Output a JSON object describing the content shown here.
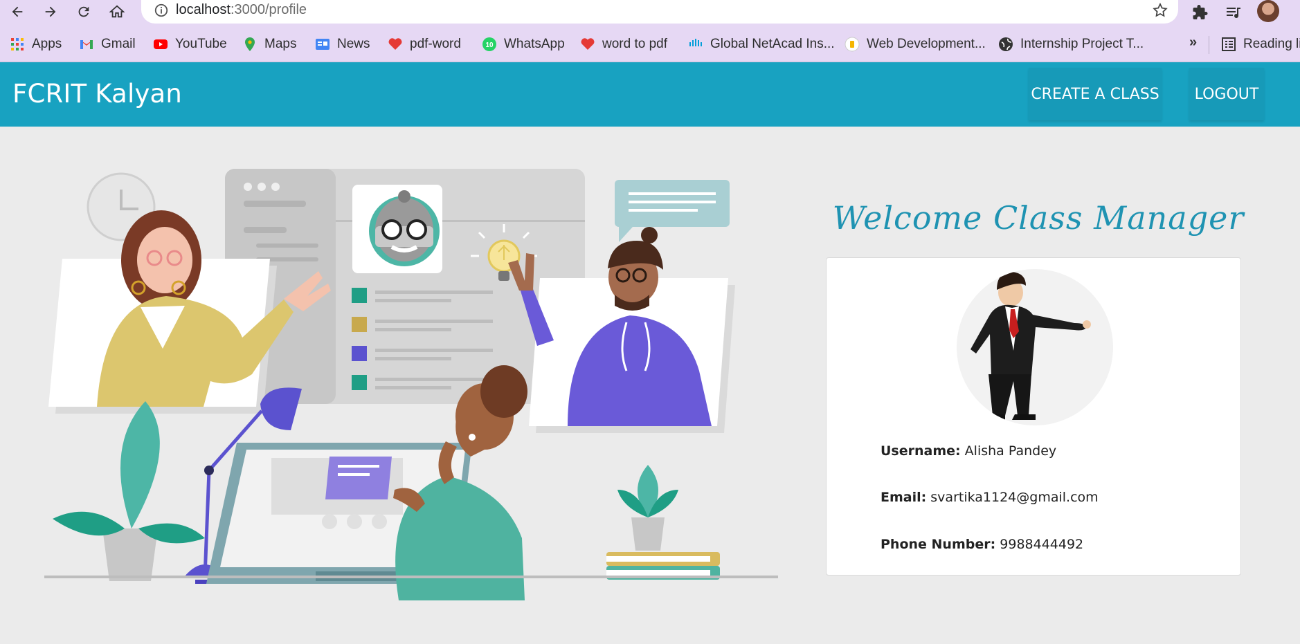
{
  "browser": {
    "url_host": "localhost",
    "url_path": ":3000/profile",
    "icons": {
      "back": "arrow-left-icon",
      "forward": "arrow-right-icon",
      "reload": "reload-icon",
      "home": "home-icon",
      "info": "info-icon",
      "bookmark_star": "star-icon",
      "extensions": "puzzle-icon",
      "media": "playlist-icon"
    }
  },
  "bookmarks": {
    "items": [
      {
        "label": "Apps",
        "icon": "apps-grid-icon"
      },
      {
        "label": "Gmail",
        "icon": "gmail-icon"
      },
      {
        "label": "YouTube",
        "icon": "youtube-icon"
      },
      {
        "label": "Maps",
        "icon": "maps-pin-icon"
      },
      {
        "label": "News",
        "icon": "news-icon"
      },
      {
        "label": "pdf-word",
        "icon": "heart-icon"
      },
      {
        "label": "WhatsApp",
        "icon": "whatsapp-icon"
      },
      {
        "label": "word to pdf",
        "icon": "heart-icon"
      },
      {
        "label": "Global NetAcad Ins...",
        "icon": "cisco-icon"
      },
      {
        "label": "Web Development...",
        "icon": "site-icon"
      },
      {
        "label": "Internship Project T...",
        "icon": "globe-icon"
      }
    ],
    "whatsapp_badge": "10",
    "more": "»",
    "reading_list": "Reading li"
  },
  "app": {
    "brand": "FCRIT Kalyan",
    "create_class": "CREATE A CLASS",
    "logout": "LOGOUT"
  },
  "profile": {
    "welcome": "Welcome Class Manager",
    "username_label": "Username:",
    "username": "Alisha Pandey",
    "email_label": "Email:",
    "email": "svartika1124@gmail.com",
    "phone_label": "Phone Number:",
    "phone": "9988444492"
  },
  "colors": {
    "navbar": "#18a2c1",
    "welcome_text": "#1f93b2",
    "page_bg": "#ebebeb",
    "chrome_bg": "#e6d8f4"
  }
}
